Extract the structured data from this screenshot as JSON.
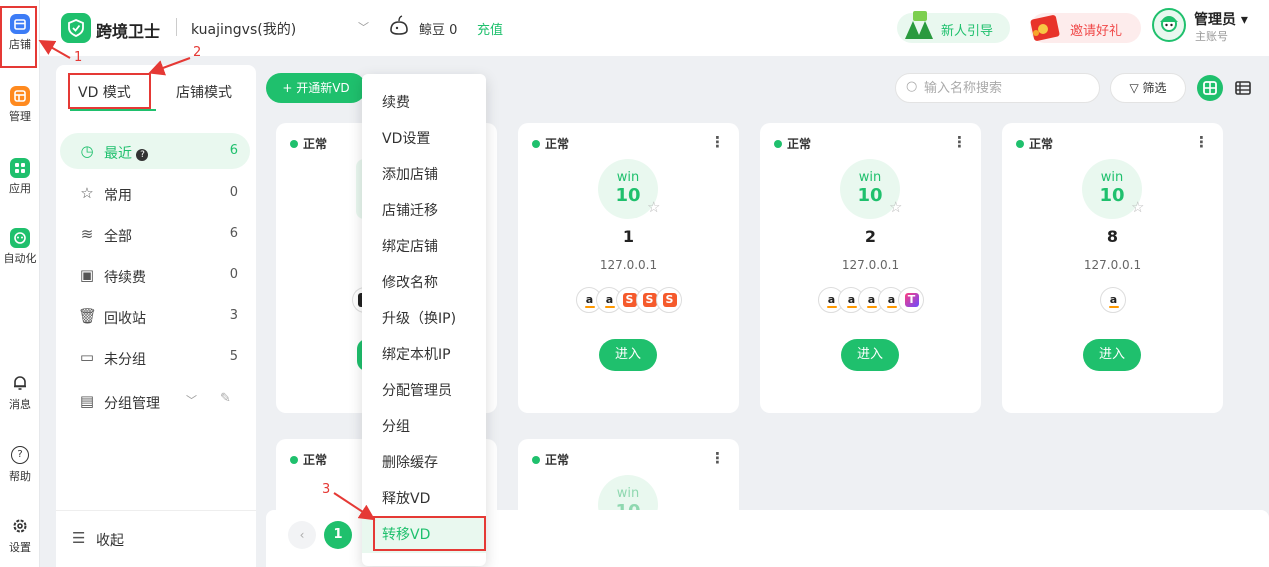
{
  "rail": [
    {
      "label": "店铺",
      "icon": "store-icon"
    },
    {
      "label": "管理",
      "icon": "manage-icon"
    },
    {
      "label": "应用",
      "icon": "apps-icon"
    },
    {
      "label": "自动化",
      "icon": "robot-icon"
    },
    {
      "label": "消息",
      "icon": "bell-icon"
    },
    {
      "label": "帮助",
      "icon": "help-icon"
    },
    {
      "label": "设置",
      "icon": "gear-icon"
    }
  ],
  "header": {
    "brand": "跨境卫士",
    "account": "kuajingvs(我的)",
    "beans": "鲸豆 0",
    "recharge": "充值",
    "guide": "新人引导",
    "invite": "邀请好礼",
    "admin_name": "管理员",
    "admin_role": "主账号"
  },
  "sidebar": {
    "tabs": [
      "VD 模式",
      "店铺模式"
    ],
    "items": [
      {
        "label": "最近",
        "count": "6"
      },
      {
        "label": "常用",
        "count": "0"
      },
      {
        "label": "全部",
        "count": "6"
      },
      {
        "label": "待续费",
        "count": "0"
      },
      {
        "label": "回收站",
        "count": "3"
      },
      {
        "label": "未分组",
        "count": "5"
      },
      {
        "label": "分组管理",
        "count": ""
      }
    ],
    "collapse": "收起"
  },
  "toolbar": {
    "open_vd": "+ 开通新VD",
    "search_placeholder": "输入名称搜索",
    "filter": "筛选"
  },
  "cards": [
    {
      "status": "正常",
      "os": "win",
      "version": "10",
      "name": "1",
      "ip": "127.0.0.1",
      "enter": "进入"
    },
    {
      "status": "正常",
      "os": "win",
      "version": "10",
      "name": "2",
      "ip": "127.0.0.1",
      "enter": "进入"
    },
    {
      "status": "正常",
      "os": "win",
      "version": "10",
      "name": "8",
      "ip": "127.0.0.1",
      "enter": "进入"
    },
    {
      "status": "正常",
      "os": "",
      "version": "",
      "name": "",
      "ip": "",
      "enter": ""
    },
    {
      "status": "正常",
      "os": "win",
      "version": "10",
      "name": "",
      "ip": "",
      "enter": ""
    },
    {
      "status": "正常",
      "os": "",
      "version": "",
      "name": "",
      "ip": "",
      "enter": ""
    }
  ],
  "platform_letters": {
    "amazon": "a",
    "shopee": "S",
    "tiktok": "T",
    "temu": "T"
  },
  "context_menu": [
    "续费",
    "VD设置",
    "添加店铺",
    "店铺迁移",
    "绑定店铺",
    "修改名称",
    "升级（换IP)",
    "绑定本机IP",
    "分配管理员",
    "分组",
    "删除缓存",
    "释放VD",
    "转移VD"
  ],
  "pager": {
    "prev": "‹",
    "current": "1"
  },
  "annotations": [
    "1",
    "2",
    "3"
  ],
  "colors": {
    "accent": "#1fc06d",
    "annotation": "#e53935"
  }
}
